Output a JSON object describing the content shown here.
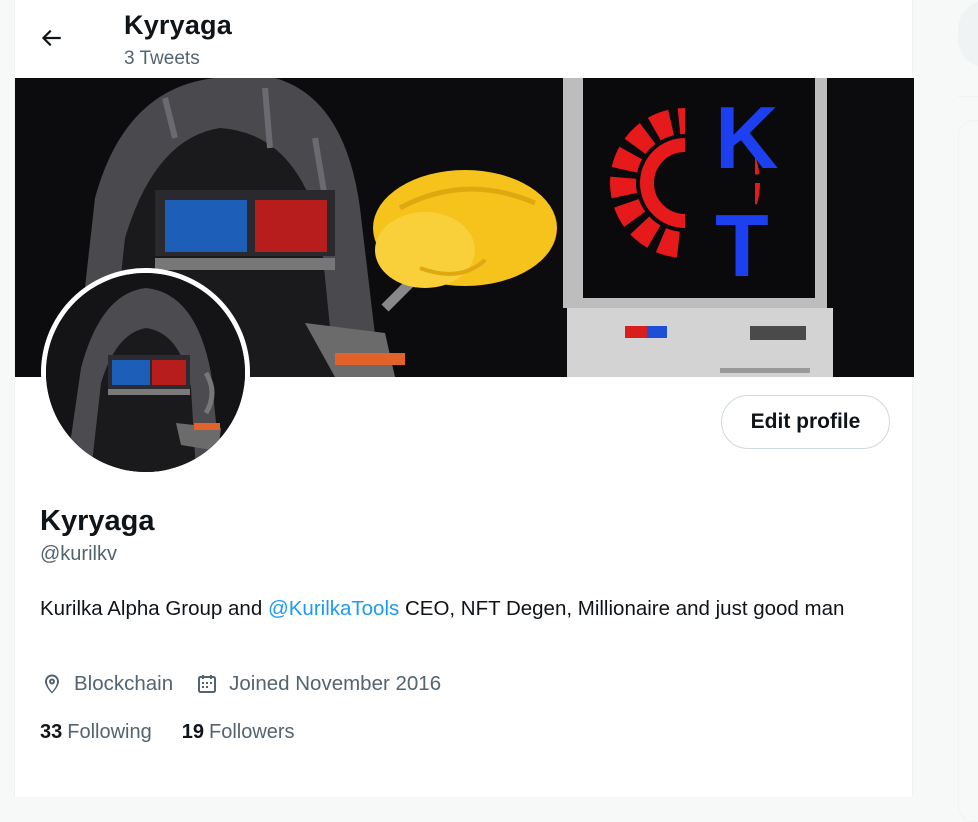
{
  "header": {
    "title": "Kyryaga",
    "subtitle": "3 Tweets"
  },
  "banner": {
    "logo_letters": [
      "K",
      "T"
    ]
  },
  "profile": {
    "edit_label": "Edit profile",
    "name": "Kyryaga",
    "handle": "@kurilkv",
    "bio": {
      "before": "Kurilka Alpha Group and ",
      "mention": "@KurilkaTools",
      "after": " CEO, NFT Degen, Millionaire and just good man"
    },
    "location": "Blockchain",
    "joined": "Joined November 2016",
    "following_count": "33",
    "following_label": "Following",
    "followers_count": "19",
    "followers_label": "Followers"
  },
  "colors": {
    "accent": "#1d9bf0",
    "text_primary": "#0f1419",
    "text_secondary": "#536471",
    "border": "#cfd9de"
  },
  "icons": [
    "back-arrow-icon",
    "location-pin-icon",
    "calendar-icon"
  ]
}
